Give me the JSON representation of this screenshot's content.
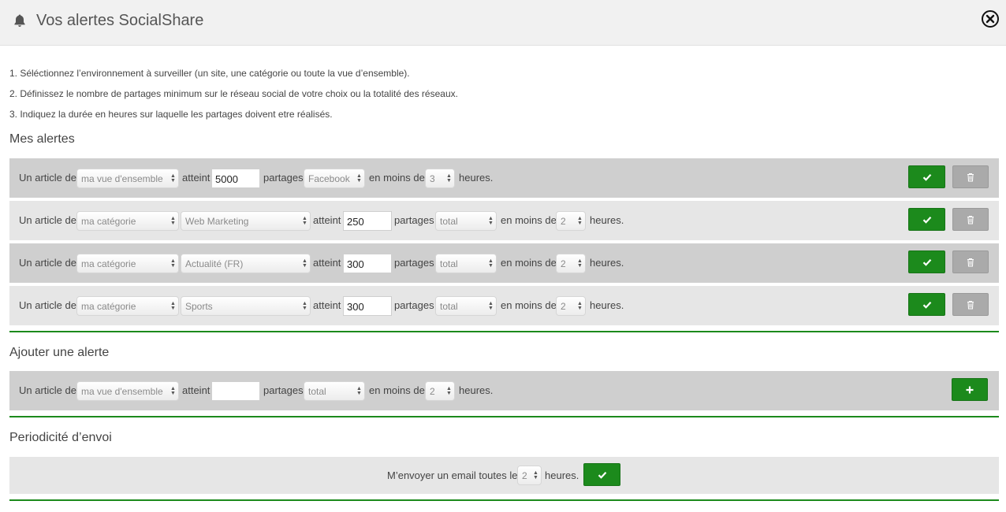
{
  "header": {
    "title": "Vos alertes SocialShare",
    "icon": "bell-icon",
    "close_icon": "close-circle-icon"
  },
  "instructions": [
    "1. Séléctionnez l’environnement à surveiller (un site, une catégorie ou toute la vue d’ensemble).",
    "2. Définissez le nombre de partages minimum sur le réseau social de votre choix ou la totalité des réseaux.",
    "3. Indiquez la durée en heures sur laquelle les partages doivent etre réalisés."
  ],
  "labels": {
    "article": "Un article de",
    "reaches": "atteint",
    "shares": "partages",
    "within": "en moins de",
    "hours": "heures."
  },
  "alerts_section": {
    "title": "Mes alertes"
  },
  "alerts": [
    {
      "scope": "ma vue d'ensemble",
      "category": "",
      "threshold": "5000",
      "network": "Facebook",
      "duration": "3"
    },
    {
      "scope": "ma catégorie",
      "category": "Web Marketing",
      "threshold": "250",
      "network": "total",
      "duration": "2"
    },
    {
      "scope": "ma catégorie",
      "category": "Actualité (FR)",
      "threshold": "300",
      "network": "total",
      "duration": "2"
    },
    {
      "scope": "ma catégorie",
      "category": "Sports",
      "threshold": "300",
      "network": "total",
      "duration": "2"
    }
  ],
  "add_section": {
    "title": "Ajouter une alerte",
    "scope": "ma vue d'ensemble",
    "threshold": "",
    "network": "total",
    "duration": "2"
  },
  "period_section": {
    "title": "Periodicité d’envoi",
    "label": "M’envoyer un email toutes les",
    "value": "2",
    "suffix": "heures."
  },
  "colors": {
    "accent": "#1c8a1c",
    "row_dark": "#cfcfcf",
    "row_light": "#e6e6e6",
    "delete": "#aaaaaa",
    "header_bg": "#f1f1f1"
  }
}
